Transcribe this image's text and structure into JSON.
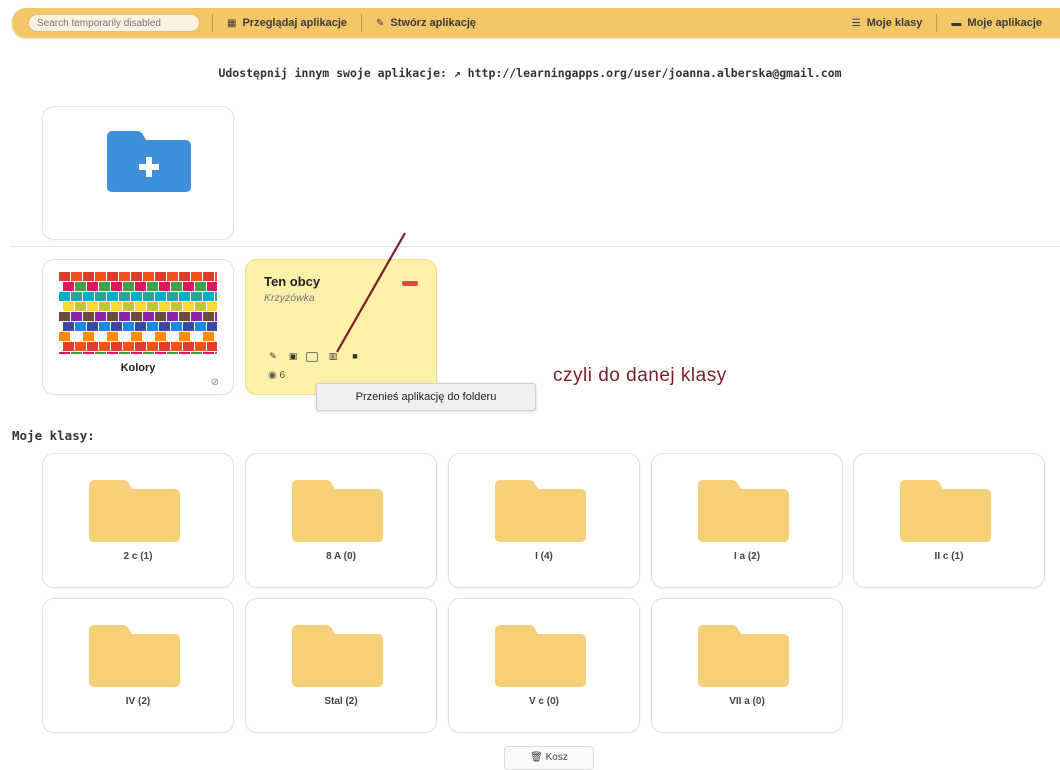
{
  "nav": {
    "search_placeholder": "Search temporarily disabled",
    "browse_label": "Przeglądaj aplikacje",
    "create_label": "Stwórz aplikację",
    "classes_label": "Moje klasy",
    "apps_label": "Moje aplikacje",
    "accent": "#f4c766"
  },
  "share": {
    "text": "Udostępnij innym swoje aplikacje: ↗ http://learningapps.org/user/joanna.alberska@gmail.com"
  },
  "apps": [
    {
      "title": "Kolory"
    },
    {
      "title": "Ten obcy",
      "subtitle": "Krzyżówka",
      "views": "6"
    }
  ],
  "tooltip": "Przenieś aplikację do folderu",
  "annotation": "czyli do danej klasy",
  "classes_heading": "Moje klasy:",
  "classes": [
    "2 c (1)",
    "8 A (0)",
    "I (4)",
    "I a (2)",
    "II c (1)",
    "IV (2)",
    "Stal (2)",
    "V c (0)",
    "VII a (0)"
  ],
  "trash_label": "Kosz",
  "icons": [
    "grid-icon",
    "pencil-icon",
    "list-icon",
    "folder-icon",
    "plus-icon",
    "image-icon",
    "chart-icon",
    "stop-icon",
    "eye-icon",
    "eye-off-icon",
    "trash-icon"
  ]
}
